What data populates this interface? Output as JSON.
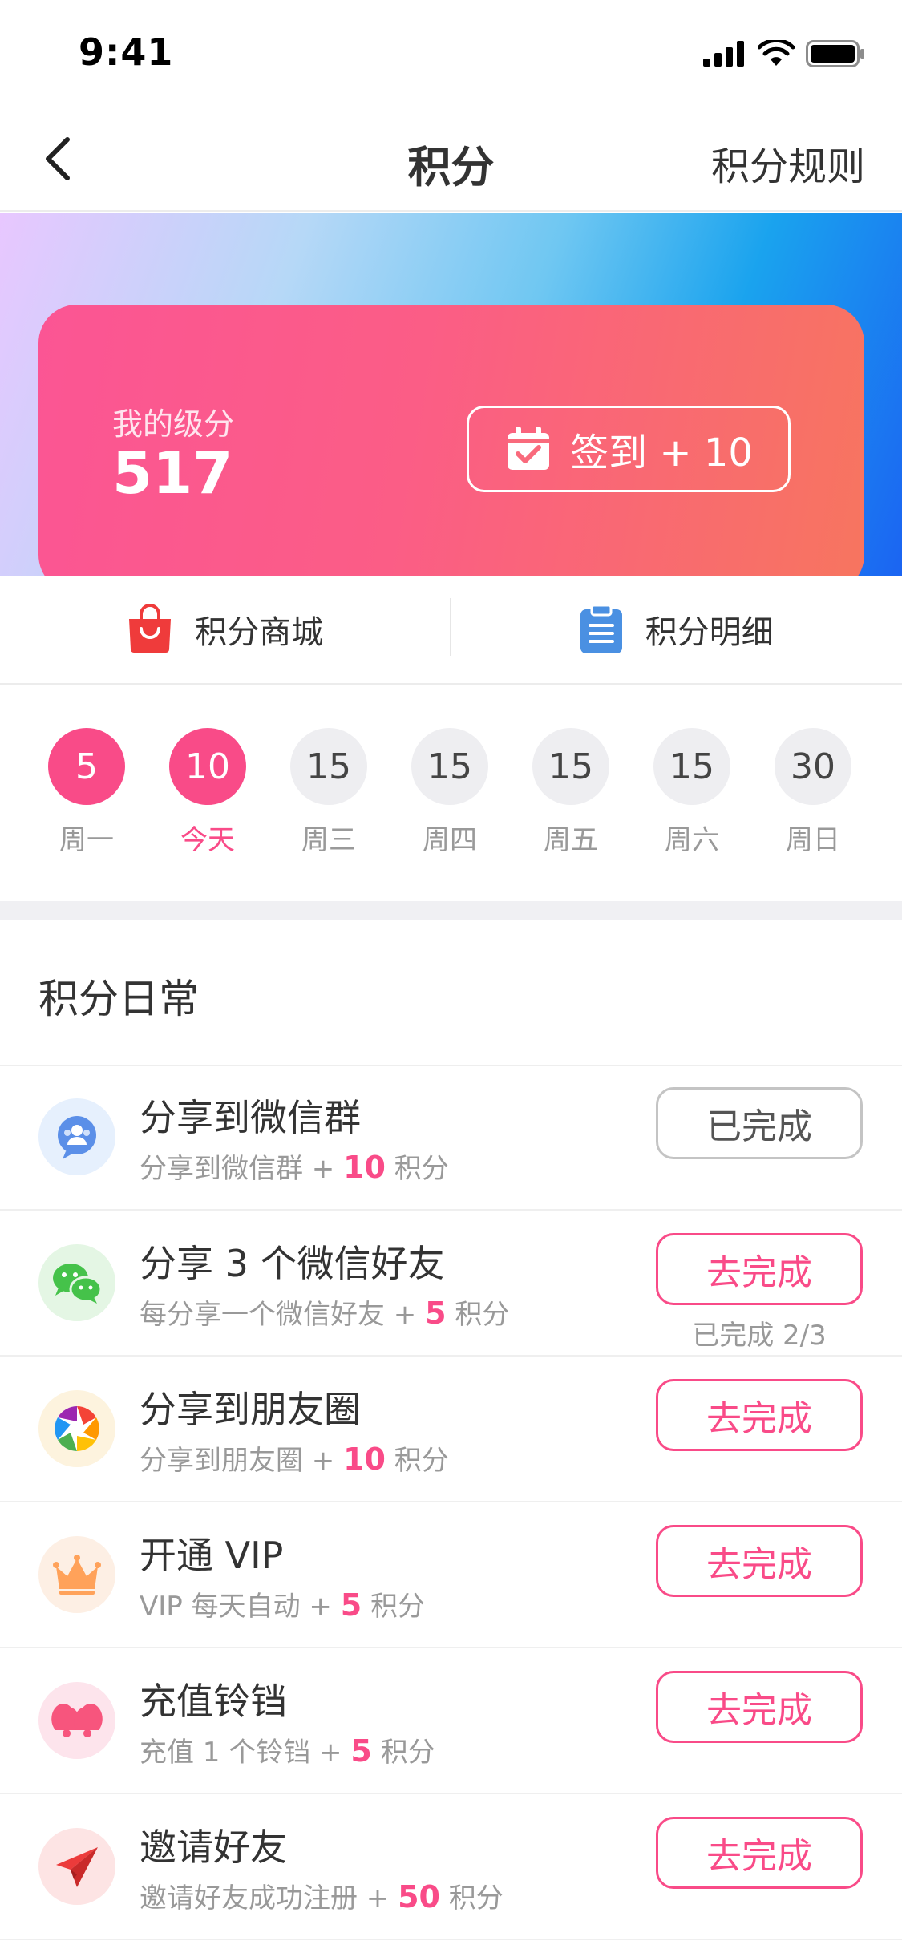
{
  "status_bar": {
    "time": "9:41"
  },
  "nav": {
    "title": "积分",
    "rules": "积分规则"
  },
  "hero": {
    "label": "我的级分",
    "points": "517",
    "checkin_label": "签到 + 10"
  },
  "quick_links": [
    {
      "label": "积分商城",
      "icon": "shopping-bag-icon",
      "color": "#ef3b3b"
    },
    {
      "label": "积分明细",
      "icon": "clipboard-icon",
      "color": "#4a90e2"
    }
  ],
  "week": [
    {
      "points": "5",
      "label": "周一",
      "active": true
    },
    {
      "points": "10",
      "label": "今天",
      "active": true,
      "today": true
    },
    {
      "points": "15",
      "label": "周三",
      "active": false
    },
    {
      "points": "15",
      "label": "周四",
      "active": false
    },
    {
      "points": "15",
      "label": "周五",
      "active": false
    },
    {
      "points": "15",
      "label": "周六",
      "active": false
    },
    {
      "points": "30",
      "label": "周日",
      "active": false
    }
  ],
  "section_title": "积分日常",
  "tasks": [
    {
      "title": "分享到微信群",
      "desc_prefix": "分享到微信群 + ",
      "points": "10",
      "desc_suffix": " 积分",
      "button": "已完成",
      "done": true,
      "icon": "wechat-group-icon"
    },
    {
      "title": "分享 3 个微信好友",
      "desc_prefix": "每分享一个微信好友 + ",
      "points": "5",
      "desc_suffix": " 积分",
      "button": "去完成",
      "done": false,
      "progress": "已完成 2/3",
      "icon": "wechat-icon"
    },
    {
      "title": "分享到朋友圈",
      "desc_prefix": "分享到朋友圈 + ",
      "points": "10",
      "desc_suffix": " 积分",
      "button": "去完成",
      "done": false,
      "icon": "moments-icon"
    },
    {
      "title": "开通 VIP",
      "desc_prefix": "VIP 每天自动 + ",
      "points": "5",
      "desc_suffix": " 积分",
      "button": "去完成",
      "done": false,
      "icon": "crown-icon"
    },
    {
      "title": "充值铃铛",
      "desc_prefix": "充值 1 个铃铛 + ",
      "points": "5",
      "desc_suffix": " 积分",
      "button": "去完成",
      "done": false,
      "icon": "bell-icon"
    },
    {
      "title": "邀请好友",
      "desc_prefix": "邀请好友成功注册 + ",
      "points": "50",
      "desc_suffix": " 积分",
      "button": "去完成",
      "done": false,
      "icon": "paper-plane-icon"
    }
  ],
  "colors": {
    "accent": "#f94b88",
    "card_start": "#fb5594",
    "card_end": "#f7755f"
  }
}
